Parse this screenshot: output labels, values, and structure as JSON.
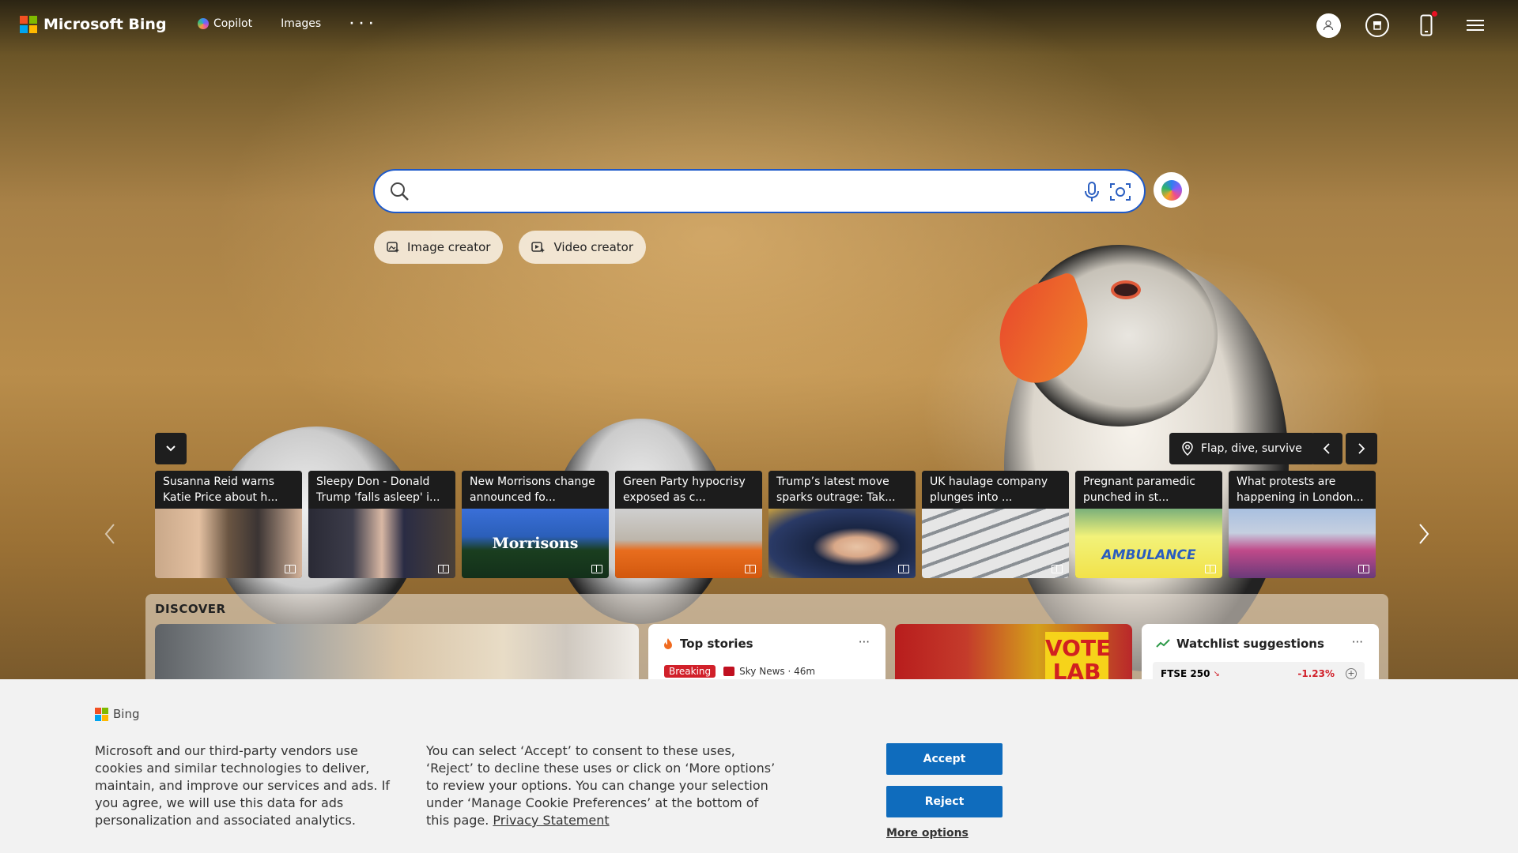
{
  "header": {
    "brand": "Microsoft Bing",
    "nav": [
      {
        "label": "Copilot",
        "icon": "copilot-icon"
      },
      {
        "label": "Images"
      },
      {
        "label": "· · ·"
      }
    ],
    "icons": [
      "user-icon",
      "rewards-icon",
      "phone-icon",
      "menu-icon"
    ]
  },
  "search": {
    "value": "",
    "placeholder": ""
  },
  "creators": [
    {
      "label": "Image creator",
      "icon": "image-creator-icon"
    },
    {
      "label": "Video creator",
      "icon": "video-creator-icon"
    }
  ],
  "carousel": {
    "location_label": "Flap, dive, survive",
    "news": [
      {
        "title": "Susanna Reid warns Katie Price about h..."
      },
      {
        "title": "Sleepy Don - Donald Trump 'falls asleep' i..."
      },
      {
        "title": "New Morrisons change announced fo..."
      },
      {
        "title": "Green Party hypocrisy exposed as c..."
      },
      {
        "title": "Trump’s latest move sparks outrage: Tak..."
      },
      {
        "title": "UK haulage company plunges into ..."
      },
      {
        "title": "Pregnant paramedic punched in st..."
      },
      {
        "title": "What protests are happening in London..."
      }
    ],
    "image_texts": {
      "morrisons": "Morrisons",
      "ambulance": "AMBULANCE"
    }
  },
  "discover": {
    "label": "DISCOVER",
    "top_stories": {
      "title": "Top stories",
      "more": "···",
      "badge": "Breaking",
      "source": "Sky News · 46m"
    },
    "vote_sign": "VOTE LAB",
    "watchlist": {
      "title": "Watchlist suggestions",
      "more": "···",
      "ticker": "FTSE 250",
      "change": "-1.23%",
      "change_color": "#d1202a"
    }
  },
  "cookie": {
    "brand": "Bing",
    "text_left": "Microsoft and our third-party vendors use cookies and similar technologies to deliver, maintain, and improve our services and ads. If you agree, we will use this data for ads personalization and associated analytics.",
    "text_right": "You can select ‘Accept’ to consent to these uses, ‘Reject’ to decline these uses or click on ‘More options’ to review your options. You can change your selection under ‘Manage Cookie Preferences’ at the bottom of this page.",
    "privacy_link": "Privacy Statement",
    "accept": "Accept",
    "reject": "Reject",
    "more_options": "More options"
  },
  "colors": {
    "accent": "#0f6cbd",
    "search_border": "#1d59c9",
    "breaking": "#d1202a"
  }
}
